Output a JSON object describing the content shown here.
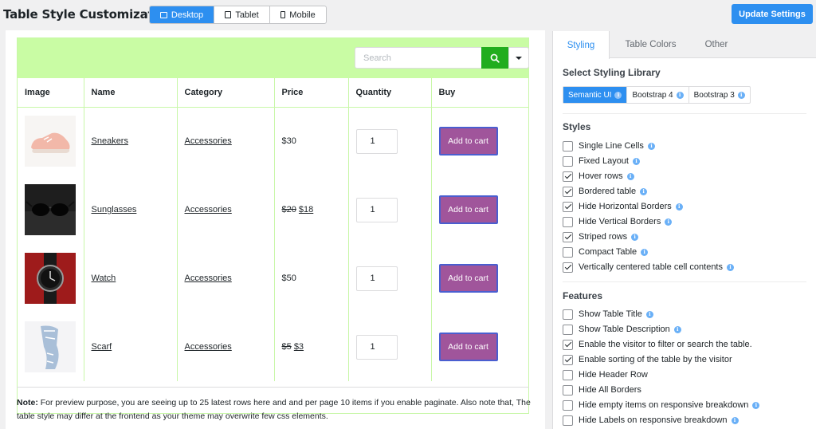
{
  "app": {
    "title": "Table Style Customization"
  },
  "devices": [
    {
      "label": "Desktop",
      "icon": "desktop-icon",
      "active": true
    },
    {
      "label": "Tablet",
      "icon": "tablet-icon",
      "active": false
    },
    {
      "label": "Mobile",
      "icon": "mobile-icon",
      "active": false
    }
  ],
  "update_label": "Update Settings",
  "search": {
    "placeholder": "Search",
    "button_icon": "search-icon",
    "dropdown_icon": "chevron-down-icon"
  },
  "table": {
    "headers": [
      "Image",
      "Name",
      "Category",
      "Price",
      "Quantity",
      "Buy"
    ],
    "rows": [
      {
        "name": "Sneakers",
        "category": "Accessories",
        "price_old": "",
        "price": "$30",
        "qty": "1",
        "buy": "Add to cart",
        "image": "sneakers"
      },
      {
        "name": "Sunglasses",
        "category": "Accessories",
        "price_old": "$20",
        "price": "$18",
        "qty": "1",
        "buy": "Add to cart",
        "image": "sunglasses"
      },
      {
        "name": "Watch",
        "category": "Accessories",
        "price_old": "",
        "price": "$50",
        "qty": "1",
        "buy": "Add to cart",
        "image": "watch"
      },
      {
        "name": "Scarf",
        "category": "Accessories",
        "price_old": "$5",
        "price": "$3",
        "qty": "1",
        "buy": "Add to cart",
        "image": "scarf"
      }
    ]
  },
  "note": {
    "label": "Note:",
    "text": " For preview purpose, you are seeing up to 25 latest rows here and and per page 10 items if you enable paginate. Also note that, The table style may differ at the frontend as your theme may overwrite few css elements."
  },
  "panel": {
    "tabs": [
      "Styling",
      "Table Colors",
      "Other"
    ],
    "library_heading": "Select Styling Library",
    "libraries": [
      {
        "label": "Semantic UI",
        "active": true
      },
      {
        "label": "Bootstrap 4",
        "active": false
      },
      {
        "label": "Bootstrap 3",
        "active": false
      }
    ],
    "styles_heading": "Styles",
    "styles": [
      {
        "label": "Single Line Cells",
        "checked": false
      },
      {
        "label": "Fixed Layout",
        "checked": false
      },
      {
        "label": "Hover rows",
        "checked": true
      },
      {
        "label": "Bordered table",
        "checked": true
      },
      {
        "label": "Hide Horizontal Borders",
        "checked": true
      },
      {
        "label": "Hide Vertical Borders",
        "checked": false
      },
      {
        "label": "Striped rows",
        "checked": true
      },
      {
        "label": "Compact Table",
        "checked": false
      },
      {
        "label": "Vertically centered table cell contents",
        "checked": true
      }
    ],
    "features_heading": "Features",
    "features": [
      {
        "label": "Show Table Title",
        "checked": false,
        "info": true
      },
      {
        "label": "Show Table Description",
        "checked": false,
        "info": true
      },
      {
        "label": "Enable the visitor to filter or search the table.",
        "checked": true,
        "info": false
      },
      {
        "label": "Enable sorting of the table by the visitor",
        "checked": true,
        "info": false
      },
      {
        "label": "Hide Header Row",
        "checked": false,
        "info": false
      },
      {
        "label": "Hide All Borders",
        "checked": false,
        "info": false
      },
      {
        "label": "Hide empty items on responsive breakdown",
        "checked": false,
        "info": true
      },
      {
        "label": "Hide Labels on responsive breakdown",
        "checked": false,
        "info": true
      }
    ]
  },
  "colors": {
    "accent": "#2d8ff0",
    "search_bar": "#c9fca4",
    "search_button": "#21ad1e",
    "cart_button": "#a0559b"
  }
}
